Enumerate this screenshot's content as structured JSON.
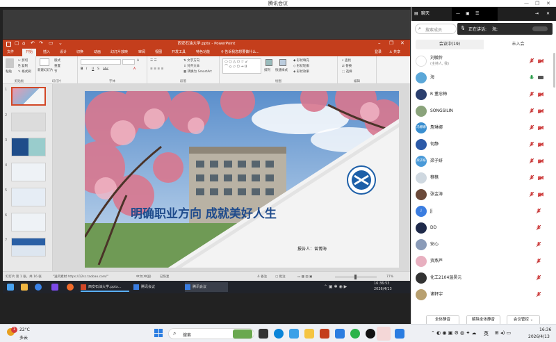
{
  "window": {
    "title": "腾讯会议"
  },
  "ppt": {
    "title": "西安石油大学.pptx - PowerPoint",
    "tabs": [
      "文件",
      "开始",
      "插入",
      "设计",
      "切换",
      "动画",
      "幻灯片放映",
      "审阅",
      "视图",
      "开发工具",
      "特色功能"
    ],
    "search_hint": "♀ 告诉我您想要做什么...",
    "login": "登录",
    "share": "共享",
    "groups": [
      "剪贴板",
      "幻灯片",
      "字体",
      "段落",
      "绘图",
      "编辑"
    ],
    "clipboard": {
      "cut": "剪切",
      "copy": "复制",
      "paste_format": "格式刷",
      "paste": "粘贴"
    },
    "slides_group": {
      "new": "新建幻灯片",
      "layout": "版式",
      "reset": "重置",
      "section": "节"
    },
    "paragraph": {
      "dir": "文字方向",
      "align": "对齐文本",
      "smartart": "转换为 SmartArt"
    },
    "drawing": {
      "arrange": "排列",
      "quick": "快速样式",
      "fill": "形状填充",
      "outline": "形状轮廓",
      "effect": "形状效果"
    },
    "editing": {
      "find": "查找",
      "replace": "替换",
      "select": "选择"
    },
    "slide_numbers": [
      "1",
      "2",
      "3",
      "4",
      "5",
      "6",
      "7"
    ],
    "slide": {
      "title": "明确职业方向  成就美好人生",
      "reporter": "报告人：曾博海"
    },
    "status": {
      "page": "幻灯片 第 1 张，共 16 张",
      "theme": "\"送风素材 https://12sc.taobao.com/\"",
      "lang": "中文(中国)",
      "recover": "已恢复",
      "notes": "备注",
      "comments": "批注",
      "zoom": "77%"
    }
  },
  "inner_taskbar": {
    "items": [
      "西安石油大学.pptx...",
      "腾讯会议",
      "腾讯会议"
    ],
    "time": "16:36:53",
    "date": "2026/4/13"
  },
  "panel": {
    "chat": "聊天",
    "search_placeholder": "搜索成员",
    "speaking_label": "正在讲话:",
    "speaking_name": "海;",
    "tab_in": "会议中(19)",
    "tab_out": "未入会",
    "members": [
      {
        "name": "刘毓伶",
        "sub": "(主持人, 我)",
        "avatar": "",
        "color": "#ffffff"
      },
      {
        "name": "海",
        "avatar": "",
        "color": "#5ba7d8"
      },
      {
        "name": "R 董忠梅",
        "avatar": "",
        "color": "#2b3f6e"
      },
      {
        "name": "SONGSILIN",
        "avatar": "",
        "color": "#8aa37b"
      },
      {
        "name": "詹琳娜",
        "avatar": "冯娜娜",
        "color": "#3a8fd0"
      },
      {
        "name": "何静",
        "avatar": "",
        "color": "#2c5aa8"
      },
      {
        "name": "梁子妍",
        "avatar": "梁子妍",
        "color": "#4a9ad8"
      },
      {
        "name": "樵樵",
        "avatar": "",
        "color": "#cfd8e0"
      },
      {
        "name": "张金涛",
        "avatar": "",
        "color": "#6b4a3a"
      },
      {
        "name": "Jj",
        "avatar": "J",
        "color": "#3b7de0"
      },
      {
        "name": "DD",
        "avatar": "",
        "color": "#1f2a4a"
      },
      {
        "name": "安心",
        "avatar": "",
        "color": "#8a9bb8"
      },
      {
        "name": "资燕芦",
        "avatar": "",
        "color": "#e8b0c0"
      },
      {
        "name": "化工2104温昊元",
        "avatar": "",
        "color": "#333333"
      },
      {
        "name": "诸轩宇",
        "avatar": "",
        "color": "#b8a070"
      }
    ],
    "buttons": {
      "mute_all": "全体静音",
      "unmute_all": "解除全体静音",
      "manage": "会议管控"
    }
  },
  "taskbar": {
    "weather_temp": "22°C",
    "weather_desc": "多云",
    "search": "搜索",
    "ime": "英",
    "time": "16:36",
    "date": "2026/4/13",
    "notif": "1"
  }
}
